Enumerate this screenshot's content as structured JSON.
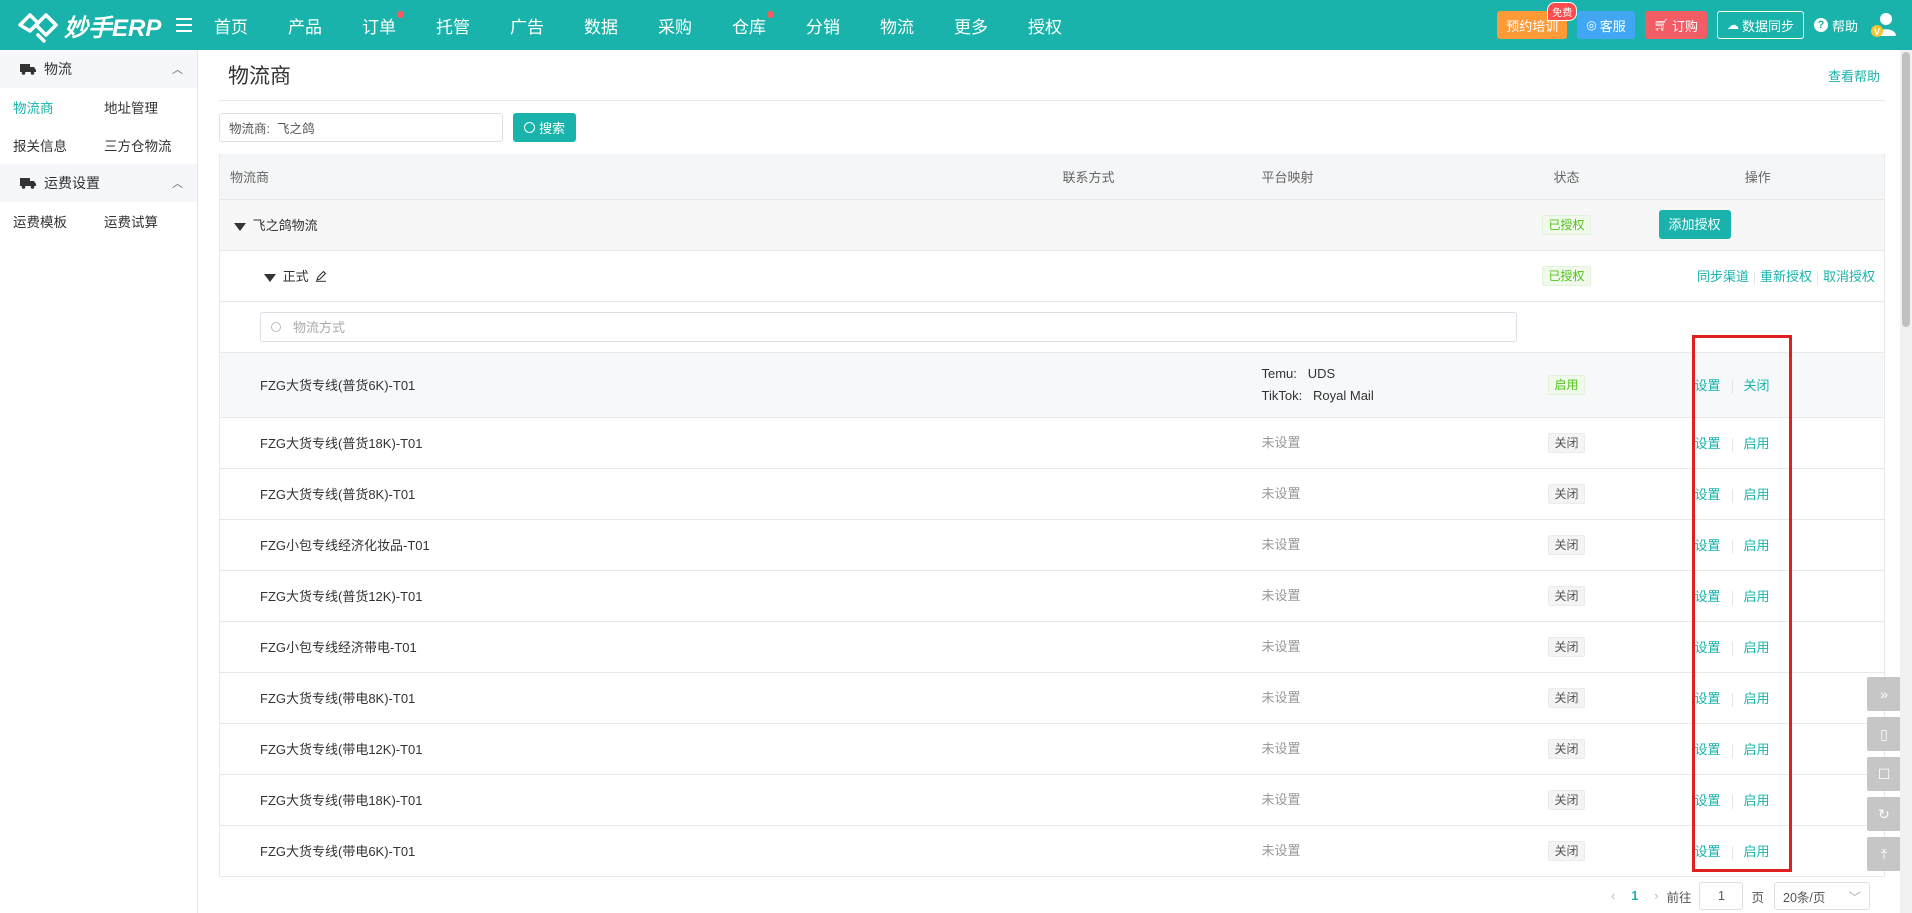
{
  "brand": {
    "name": "妙手ERP"
  },
  "nav": {
    "items": [
      {
        "label": "首页",
        "dot": false
      },
      {
        "label": "产品",
        "dot": false
      },
      {
        "label": "订单",
        "dot": true
      },
      {
        "label": "托管",
        "dot": false
      },
      {
        "label": "广告",
        "dot": false
      },
      {
        "label": "数据",
        "dot": false
      },
      {
        "label": "采购",
        "dot": false
      },
      {
        "label": "仓库",
        "dot": true
      },
      {
        "label": "分销",
        "dot": false
      },
      {
        "label": "物流",
        "dot": false
      },
      {
        "label": "更多",
        "dot": false
      },
      {
        "label": "授权",
        "dot": false
      }
    ]
  },
  "topRight": {
    "training": "预约培训",
    "trainingBadge": "免费",
    "service": "客服",
    "order": "订购",
    "sync": "数据同步",
    "help": "帮助"
  },
  "sidebar": {
    "group1": "物流",
    "group1_links": [
      "物流商",
      "地址管理",
      "报关信息",
      "三方仓物流"
    ],
    "group2": "运费设置",
    "group2_links": [
      "运费模板",
      "运费试算"
    ]
  },
  "page": {
    "title": "物流商",
    "helpLink": "查看帮助",
    "searchLabel": "物流商:",
    "searchValue": "飞之鸽",
    "searchButton": "搜索"
  },
  "table": {
    "headers": {
      "provider": "物流商",
      "contact": "联系方式",
      "mapping": "平台映射",
      "status": "状态",
      "ops": "操作"
    },
    "provider": {
      "name": "飞之鸽物流",
      "status": "已授权",
      "action": "添加授权"
    },
    "account": {
      "name": "正式",
      "status": "已授权",
      "ops": [
        "同步渠道",
        "重新授权",
        "取消授权"
      ]
    },
    "methodSearchPlaceholder": "物流方式",
    "rows": [
      {
        "name": "FZG大货专线(普货6K)-T01",
        "mapping": [
          "Temu:   UDS",
          "TikTok:   Royal Mail"
        ],
        "status": "启用",
        "op1": "设置",
        "op2": "关闭"
      },
      {
        "name": "FZG大货专线(普货18K)-T01",
        "mapping": [
          "未设置"
        ],
        "status": "关闭",
        "op1": "设置",
        "op2": "启用"
      },
      {
        "name": "FZG大货专线(普货8K)-T01",
        "mapping": [
          "未设置"
        ],
        "status": "关闭",
        "op1": "设置",
        "op2": "启用"
      },
      {
        "name": "FZG小包专线经济化妆品-T01",
        "mapping": [
          "未设置"
        ],
        "status": "关闭",
        "op1": "设置",
        "op2": "启用"
      },
      {
        "name": "FZG大货专线(普货12K)-T01",
        "mapping": [
          "未设置"
        ],
        "status": "关闭",
        "op1": "设置",
        "op2": "启用"
      },
      {
        "name": "FZG小包专线经济带电-T01",
        "mapping": [
          "未设置"
        ],
        "status": "关闭",
        "op1": "设置",
        "op2": "启用"
      },
      {
        "name": "FZG大货专线(带电8K)-T01",
        "mapping": [
          "未设置"
        ],
        "status": "关闭",
        "op1": "设置",
        "op2": "启用"
      },
      {
        "name": "FZG大货专线(带电12K)-T01",
        "mapping": [
          "未设置"
        ],
        "status": "关闭",
        "op1": "设置",
        "op2": "启用"
      },
      {
        "name": "FZG大货专线(带电18K)-T01",
        "mapping": [
          "未设置"
        ],
        "status": "关闭",
        "op1": "设置",
        "op2": "启用"
      },
      {
        "name": "FZG大货专线(带电6K)-T01",
        "mapping": [
          "未设置"
        ],
        "status": "关闭",
        "op1": "设置",
        "op2": "启用"
      }
    ]
  },
  "pager": {
    "current": "1",
    "goto": "前往",
    "input": "1",
    "pageUnit": "页",
    "size": "20条/页"
  },
  "colors": {
    "accent": "#1ab3ac",
    "highlight": "#e02020"
  }
}
